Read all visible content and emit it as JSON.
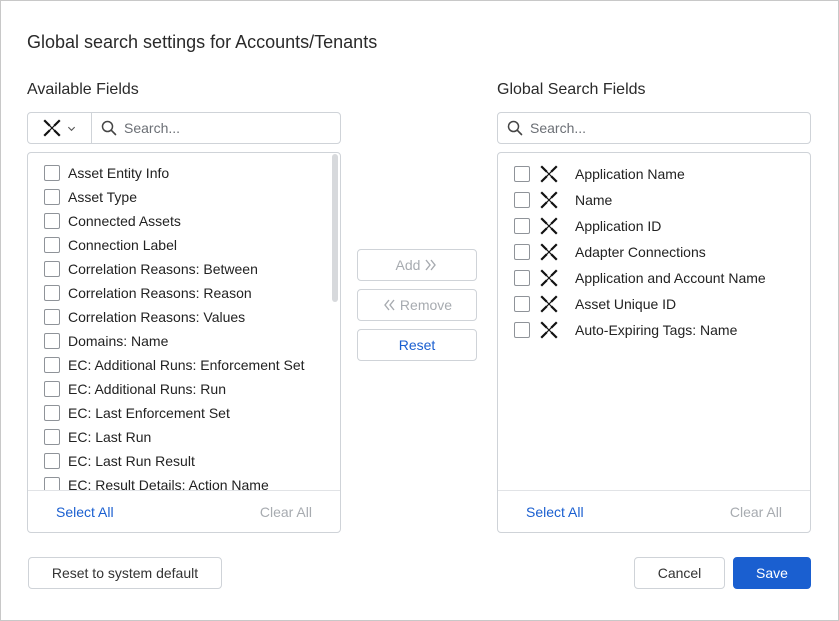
{
  "dialog": {
    "title": "Global search settings for Accounts/Tenants"
  },
  "available": {
    "title": "Available Fields",
    "type_icon": "adapter-cross-icon",
    "search_placeholder": "Search...",
    "items": [
      "Asset Entity Info",
      "Asset Type",
      "Connected Assets",
      "Connection Label",
      "Correlation Reasons: Between",
      "Correlation Reasons: Reason",
      "Correlation Reasons: Values",
      "Domains: Name",
      "EC: Additional Runs: Enforcement Set",
      "EC: Additional Runs: Run",
      "EC: Last Enforcement Set",
      "EC: Last Run",
      "EC: Last Run Result",
      "EC: Result Details: Action Name"
    ],
    "select_all": "Select All",
    "clear_all": "Clear All"
  },
  "global": {
    "title": "Global Search Fields",
    "search_placeholder": "Search...",
    "items": [
      "Application Name",
      "Name",
      "Application ID",
      "Adapter Connections",
      "Application and Account Name",
      "Asset Unique ID",
      "Auto-Expiring Tags: Name"
    ],
    "select_all": "Select All",
    "clear_all": "Clear All"
  },
  "middle": {
    "add": "Add",
    "remove": "Remove",
    "reset": "Reset"
  },
  "footer": {
    "reset_default": "Reset to system default",
    "cancel": "Cancel",
    "save": "Save"
  },
  "colors": {
    "accent": "#1a5fd0",
    "disabled": "#a7abb0",
    "border": "#cfd3d8"
  }
}
